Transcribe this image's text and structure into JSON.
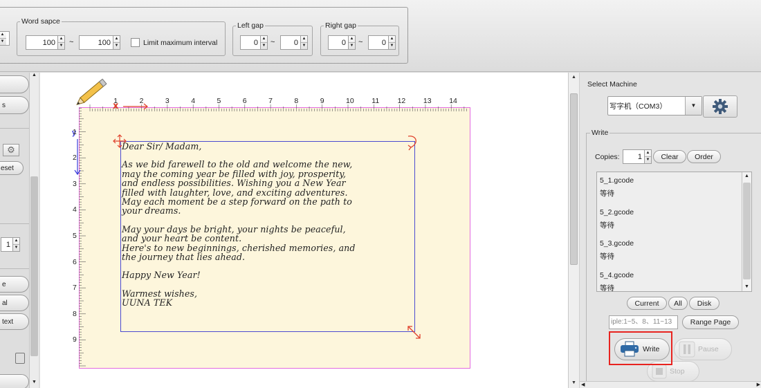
{
  "toolbar": {
    "left_spinner_value": "",
    "word_space": {
      "legend": "Word sapce",
      "min": "100",
      "sep": "~",
      "max": "100",
      "limit_label": "Limit maximum interval"
    },
    "left_gap": {
      "legend": "Left gap",
      "min": "0",
      "sep": "~",
      "max": "0"
    },
    "right_gap": {
      "legend": "Right gap",
      "min": "0",
      "sep": "~",
      "max": "0"
    }
  },
  "left_panel": {
    "items": [
      "",
      "s",
      "",
      "eset",
      "",
      "e",
      "al",
      "text"
    ],
    "spinner_value": "1"
  },
  "ruler": {
    "top_ticks": [
      "1",
      "2",
      "3",
      "4",
      "5",
      "6",
      "7",
      "8",
      "9",
      "10",
      "11",
      "12",
      "13",
      "14"
    ],
    "left_ticks": [
      "1",
      "2",
      "3",
      "4",
      "5",
      "6",
      "7",
      "8",
      "9"
    ]
  },
  "letter": {
    "lines": [
      "Dear Sir/ Madam,",
      "",
      "As we bid farewell to the old and welcome the new,",
      "may the coming year be filled with joy, prosperity,",
      "and endless possibilities. Wishing you a New Year",
      "filled with laughter, love, and exciting adventures.",
      "May each moment be a step forward on the path to",
      "your dreams.",
      "",
      "May your days be bright, your nights be peaceful,",
      "and your heart be content.",
      "Here's to new beginnings, cherished memories, and",
      "the journey that lies ahead.",
      "",
      "Happy New Year!",
      "",
      "Warmest wishes,",
      "UUNA TEK"
    ]
  },
  "right_panel": {
    "select_machine_label": "Select Machine",
    "machine_value": "写字机（COM3）",
    "write_legend": "Write",
    "copies_label": "Copies:",
    "copies_value": "1",
    "clear_label": "Clear",
    "order_label": "Order",
    "files": [
      {
        "name": "5_1.gcode",
        "status": "等待"
      },
      {
        "name": "5_2.gcode",
        "status": "等待"
      },
      {
        "name": "5_3.gcode",
        "status": "等待"
      },
      {
        "name": "5_4.gcode",
        "status": "等待"
      }
    ],
    "current_label": "Current",
    "all_label": "All",
    "disk_label": "Disk",
    "range_placeholder": "iple:1~5、8、11~13",
    "range_page_label": "Range Page",
    "write_label": "Write",
    "pause_label": "Pause",
    "stop_label": "Stop"
  },
  "colors": {
    "highlight": "#e8231f",
    "paper": "#fdf6dc",
    "paper_border": "#e36be0",
    "text_frame": "#4a4ad0",
    "handle": "#e0412c"
  }
}
